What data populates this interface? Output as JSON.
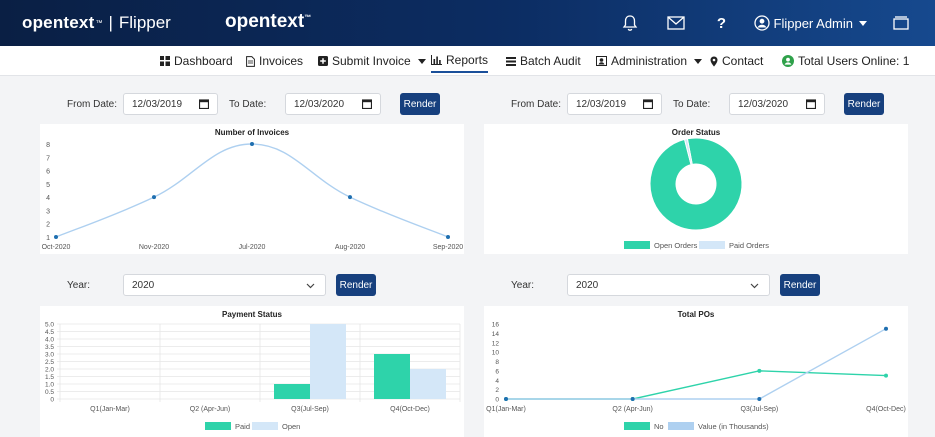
{
  "header": {
    "brand": "opentext",
    "brand_tm": "™",
    "app_name": "Flipper",
    "center_logo": "opentext",
    "center_tm": "™",
    "user_name": "Flipper Admin",
    "icons": [
      "bell-icon",
      "mail-icon",
      "help-icon",
      "user-circle-icon",
      "window-icon"
    ],
    "help_label": "?"
  },
  "nav": {
    "dashboard": "Dashboard",
    "invoices": "Invoices",
    "submit_invoice": "Submit Invoice",
    "reports": "Reports",
    "batch_audit": "Batch Audit",
    "administration": "Administration",
    "contact": "Contact",
    "users_online": "Total Users Online: 1",
    "active": "reports"
  },
  "filters": {
    "left": {
      "from_label": "From Date:",
      "from_value": "12/03/2019",
      "to_label": "To Date:",
      "to_value": "12/03/2020",
      "button": "Render"
    },
    "right": {
      "from_label": "From Date:",
      "from_value": "12/03/2019",
      "to_label": "To Date:",
      "to_value": "12/03/2020",
      "button": "Render"
    },
    "year_left": {
      "label": "Year:",
      "value": "2020",
      "button": "Render"
    },
    "year_right": {
      "label": "Year:",
      "value": "2020",
      "button": "Render"
    }
  },
  "colors": {
    "teal": "#2ed3aa",
    "light_blue": "#d4e7f8",
    "line_blue": "#aed0f0",
    "point_blue": "#1f6fb0",
    "nav_active": "#1a4f9a",
    "button": "#17407e"
  },
  "chart_data": [
    {
      "id": "invoices",
      "type": "line",
      "title": "Number of Invoices",
      "categories": [
        "Oct-2020",
        "Nov-2020",
        "Jul-2020",
        "Aug-2020",
        "Sep-2020"
      ],
      "values": [
        1,
        4,
        8,
        4,
        1
      ],
      "ylim": [
        1,
        8
      ],
      "yticks": [
        "1",
        "2",
        "3",
        "4",
        "5",
        "6",
        "7",
        "8"
      ],
      "smooth": true,
      "grid": false
    },
    {
      "id": "order_status",
      "type": "pie",
      "title": "Order Status",
      "doughnut": true,
      "labels": [
        "Open Orders",
        "Paid Orders"
      ],
      "values": [
        99,
        1
      ],
      "colors": [
        "#2ed3aa",
        "#d4e7f8"
      ],
      "legend": "bottom"
    },
    {
      "id": "payment_status",
      "type": "bar",
      "title": "Payment Status",
      "categories": [
        "Q1(Jan-Mar)",
        "Q2 (Apr-Jun)",
        "Q3(Jul-Sep)",
        "Q4(Oct-Dec)"
      ],
      "series": [
        {
          "name": "Paid",
          "values": [
            0,
            0,
            1,
            3
          ],
          "color": "#2ed3aa"
        },
        {
          "name": "Open",
          "values": [
            0,
            0,
            5,
            2
          ],
          "color": "#d4e7f8"
        }
      ],
      "ylim": [
        0,
        5
      ],
      "yticks": [
        "0",
        "0.5",
        "1.0",
        "1.5",
        "2.0",
        "2.5",
        "3.0",
        "3.5",
        "4.0",
        "4.5",
        "5.0"
      ],
      "grid": true,
      "legend": "bottom"
    },
    {
      "id": "total_pos",
      "type": "line",
      "title": "Total POs",
      "categories": [
        "Q1(Jan-Mar)",
        "Q2 (Apr-Jun)",
        "Q3(Jul-Sep)",
        "Q4(Oct-Dec)"
      ],
      "series": [
        {
          "name": "No",
          "values": [
            0,
            0,
            6,
            5
          ],
          "color": "#2ed3aa"
        },
        {
          "name": "Value (in Thousands)",
          "values": [
            0,
            0,
            0,
            15
          ],
          "color": "#aed0f0"
        }
      ],
      "ylim": [
        0,
        16
      ],
      "yticks": [
        "0",
        "2",
        "4",
        "6",
        "8",
        "10",
        "12",
        "14",
        "16"
      ],
      "grid": false,
      "legend": "bottom"
    }
  ]
}
